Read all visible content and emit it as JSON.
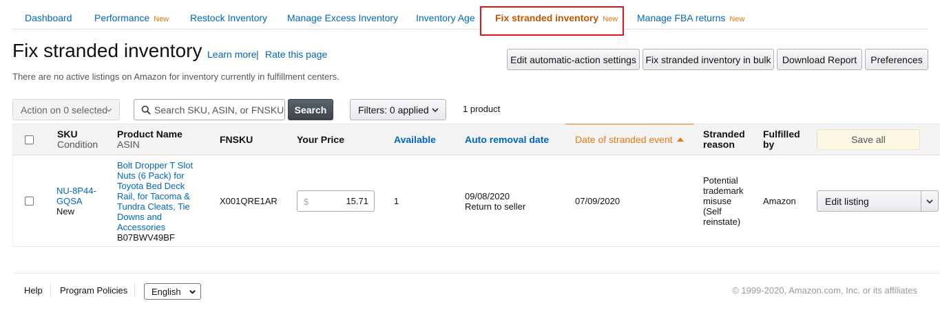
{
  "tabs": [
    {
      "label": "Dashboard",
      "badge": ""
    },
    {
      "label": "Performance",
      "badge": "New"
    },
    {
      "label": "Restock Inventory",
      "badge": ""
    },
    {
      "label": "Manage Excess Inventory",
      "badge": ""
    },
    {
      "label": "Inventory Age",
      "badge": ""
    },
    {
      "label": "Fix stranded inventory",
      "badge": "New",
      "active": true
    },
    {
      "label": "Manage FBA returns",
      "badge": "New"
    }
  ],
  "header": {
    "title": "Fix stranded inventory",
    "learn_more": "Learn more",
    "separator": "|",
    "rate_page": "Rate this page",
    "subtitle": "There are no active listings on Amazon for inventory currently in fulfillment centers."
  },
  "actions": {
    "edit_auto": "Edit automatic-action settings",
    "fix_bulk": "Fix stranded inventory in bulk",
    "download": "Download Report",
    "preferences": "Preferences"
  },
  "toolbar": {
    "action_select": "Action on 0 selected",
    "search_placeholder": "Search SKU, ASIN, or FNSKU",
    "search_button": "Search",
    "filters": "Filters: 0 applied",
    "product_count": "1 product"
  },
  "table": {
    "headers": {
      "sku": "SKU",
      "condition": "Condition",
      "product_name": "Product Name",
      "asin": "ASIN",
      "fnsku": "FNSKU",
      "your_price": "Your Price",
      "available": "Available",
      "auto_removal": "Auto removal date",
      "stranded_date": "Date of stranded event",
      "stranded_reason_1": "Stranded",
      "stranded_reason_2": "reason",
      "fulfilled_by_1": "Fulfilled",
      "fulfilled_by_2": "by",
      "save_all": "Save all"
    },
    "rows": [
      {
        "sku_1": "NU-8P44-",
        "sku_2": "GQSA",
        "condition": "New",
        "product_name": "Bolt Dropper T Slot Nuts (6 Pack) for Toyota Bed Deck Rail, for Tacoma & Tundra Cleats, Tie Downs and Accessories",
        "asin": "B07BWV49BF",
        "fnsku": "X001QRE1AR",
        "currency": "$",
        "price": "15.71",
        "available": "1",
        "removal_date": "09/08/2020",
        "removal_action": "Return to seller",
        "stranded_date": "07/09/2020",
        "reason": "Potential trademark misuse (Self reinstate)",
        "fulfilled_by": "Amazon",
        "edit_button": "Edit listing"
      }
    ]
  },
  "footer": {
    "help": "Help",
    "policies": "Program Policies",
    "language": "English",
    "copyright": "© 1999-2020, Amazon.com, Inc. or its affiliates"
  },
  "colors": {
    "link": "#0066c0",
    "accent_orange": "#e47911",
    "highlight_box": "#e0131a"
  }
}
